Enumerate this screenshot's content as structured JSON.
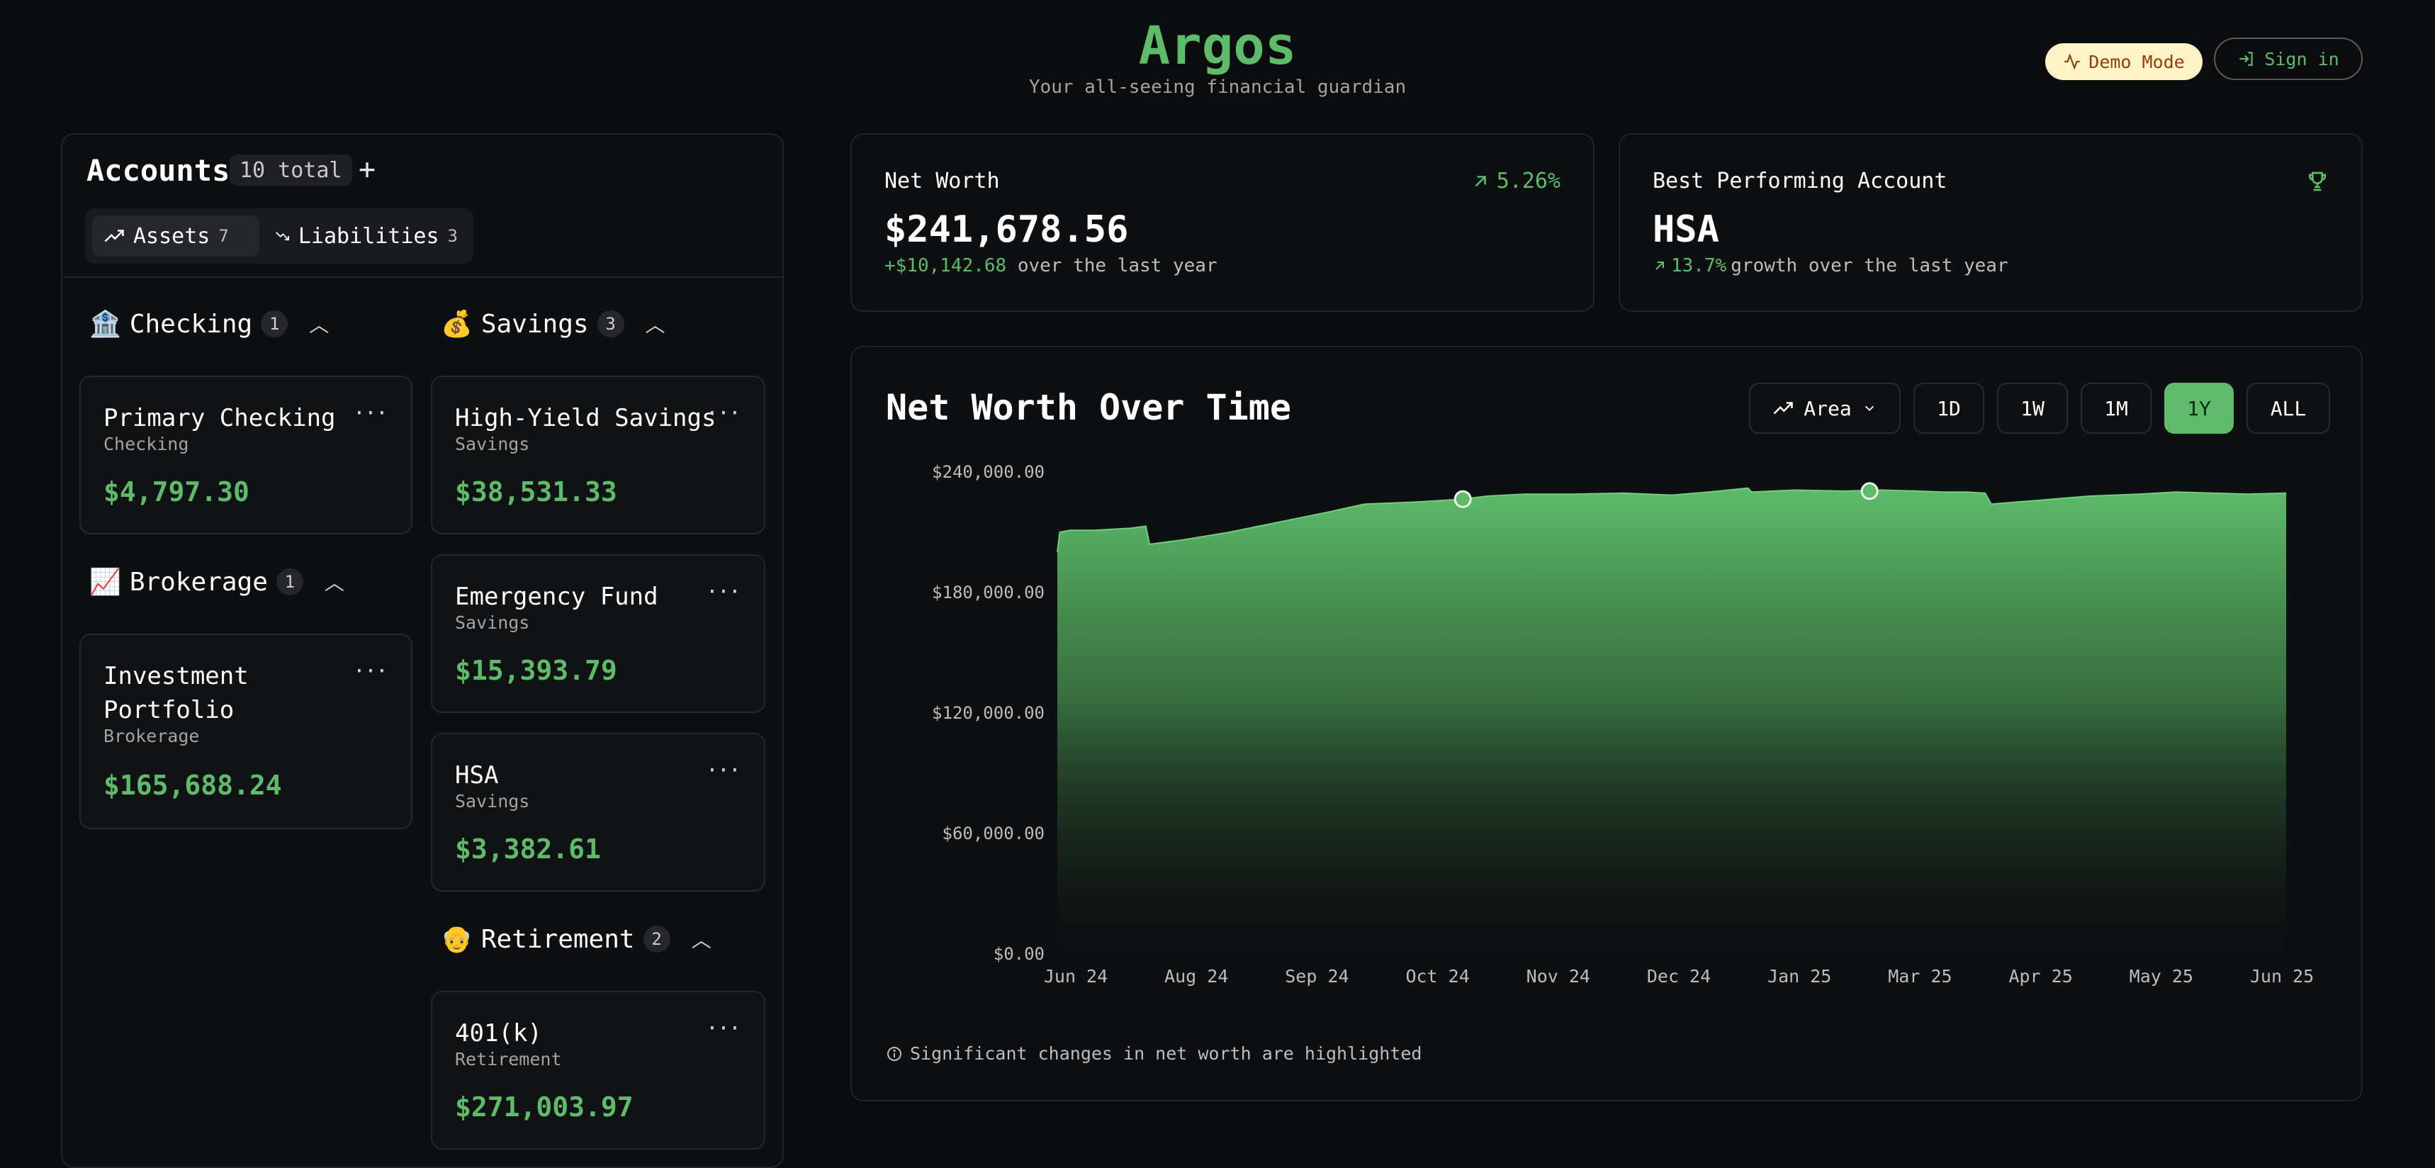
{
  "header": {
    "title": "Argos",
    "subtitle": "Your all-seeing financial guardian",
    "demo_label": "Demo Mode",
    "signin_label": "Sign in"
  },
  "accounts": {
    "title": "Accounts",
    "total_badge": "10 total",
    "add_label": "+",
    "tabs": [
      {
        "label": "Assets",
        "count": "7",
        "active": true
      },
      {
        "label": "Liabilities",
        "count": "3",
        "active": false
      }
    ],
    "groups": {
      "checking": {
        "emoji": "🏦",
        "label": "Checking",
        "count": "1",
        "items": [
          {
            "name": "Primary Checking",
            "type": "Checking",
            "amount": "$4,797.30"
          }
        ]
      },
      "brokerage": {
        "emoji": "📈",
        "label": "Brokerage",
        "count": "1",
        "items": [
          {
            "name": "Investment Portfolio",
            "type": "Brokerage",
            "amount": "$165,688.24"
          }
        ]
      },
      "savings": {
        "emoji": "💰",
        "label": "Savings",
        "count": "3",
        "items": [
          {
            "name": "High-Yield Savings",
            "type": "Savings",
            "amount": "$38,531.33"
          },
          {
            "name": "Emergency Fund",
            "type": "Savings",
            "amount": "$15,393.79"
          },
          {
            "name": "HSA",
            "type": "Savings",
            "amount": "$3,382.61"
          }
        ]
      },
      "retirement": {
        "emoji": "👴",
        "label": "Retirement",
        "count": "2",
        "items": [
          {
            "name": "401(k)",
            "type": "Retirement",
            "amount": "$271,003.97"
          }
        ]
      }
    }
  },
  "net_worth": {
    "label": "Net Worth",
    "change_pct": "5.26%",
    "value": "$241,678.56",
    "delta": "+$10,142.68",
    "delta_suffix": "over the last year"
  },
  "best_account": {
    "label": "Best Performing Account",
    "name": "HSA",
    "growth": "13.7%",
    "growth_suffix": "growth over the last year"
  },
  "chart_panel": {
    "title": "Net Worth Over Time",
    "chart_type_label": "Area",
    "ranges": [
      "1D",
      "1W",
      "1M",
      "1Y",
      "ALL"
    ],
    "active_range": "1Y",
    "note": "Significant changes in net worth are highlighted"
  },
  "chart_data": {
    "type": "area",
    "title": "Net Worth Over Time",
    "x_ticks": [
      "Jun 24",
      "Aug 24",
      "Sep 24",
      "Oct 24",
      "Nov 24",
      "Dec 24",
      "Jan 25",
      "Mar 25",
      "Apr 25",
      "May 25",
      "Jun 25"
    ],
    "y_ticks": [
      "$0.00",
      "$60,000.00",
      "$120,000.00",
      "$180,000.00",
      "$240,000.00"
    ],
    "ylim": [
      0,
      240000
    ],
    "grid": false,
    "color": "#5dbb6a",
    "series": [
      {
        "values": [
          [
            0.0,
            200000
          ],
          [
            0.002,
            210000
          ],
          [
            0.01,
            211000
          ],
          [
            0.03,
            211000
          ],
          [
            0.06,
            212000
          ],
          [
            0.072,
            213000
          ],
          [
            0.075,
            204000
          ],
          [
            0.1,
            206000
          ],
          [
            0.14,
            210000
          ],
          [
            0.18,
            215000
          ],
          [
            0.22,
            220000
          ],
          [
            0.25,
            224000
          ],
          [
            0.29,
            225000
          ],
          [
            0.33,
            226500
          ],
          [
            0.35,
            228000
          ],
          [
            0.38,
            229000
          ],
          [
            0.42,
            229000
          ],
          [
            0.46,
            229500
          ],
          [
            0.5,
            228500
          ],
          [
            0.53,
            230000
          ],
          [
            0.562,
            232000
          ],
          [
            0.565,
            230000
          ],
          [
            0.6,
            231000
          ],
          [
            0.64,
            230500
          ],
          [
            0.67,
            231000
          ],
          [
            0.7,
            230500
          ],
          [
            0.72,
            230000
          ],
          [
            0.74,
            230000
          ],
          [
            0.755,
            229500
          ],
          [
            0.76,
            224000
          ],
          [
            0.8,
            226000
          ],
          [
            0.84,
            228000
          ],
          [
            0.88,
            229000
          ],
          [
            0.91,
            230000
          ],
          [
            0.94,
            229500
          ],
          [
            0.97,
            229000
          ],
          [
            1.0,
            229500
          ]
        ],
        "highlights": [
          [
            0.33,
            226500
          ],
          [
            0.661,
            230500
          ]
        ]
      }
    ]
  }
}
